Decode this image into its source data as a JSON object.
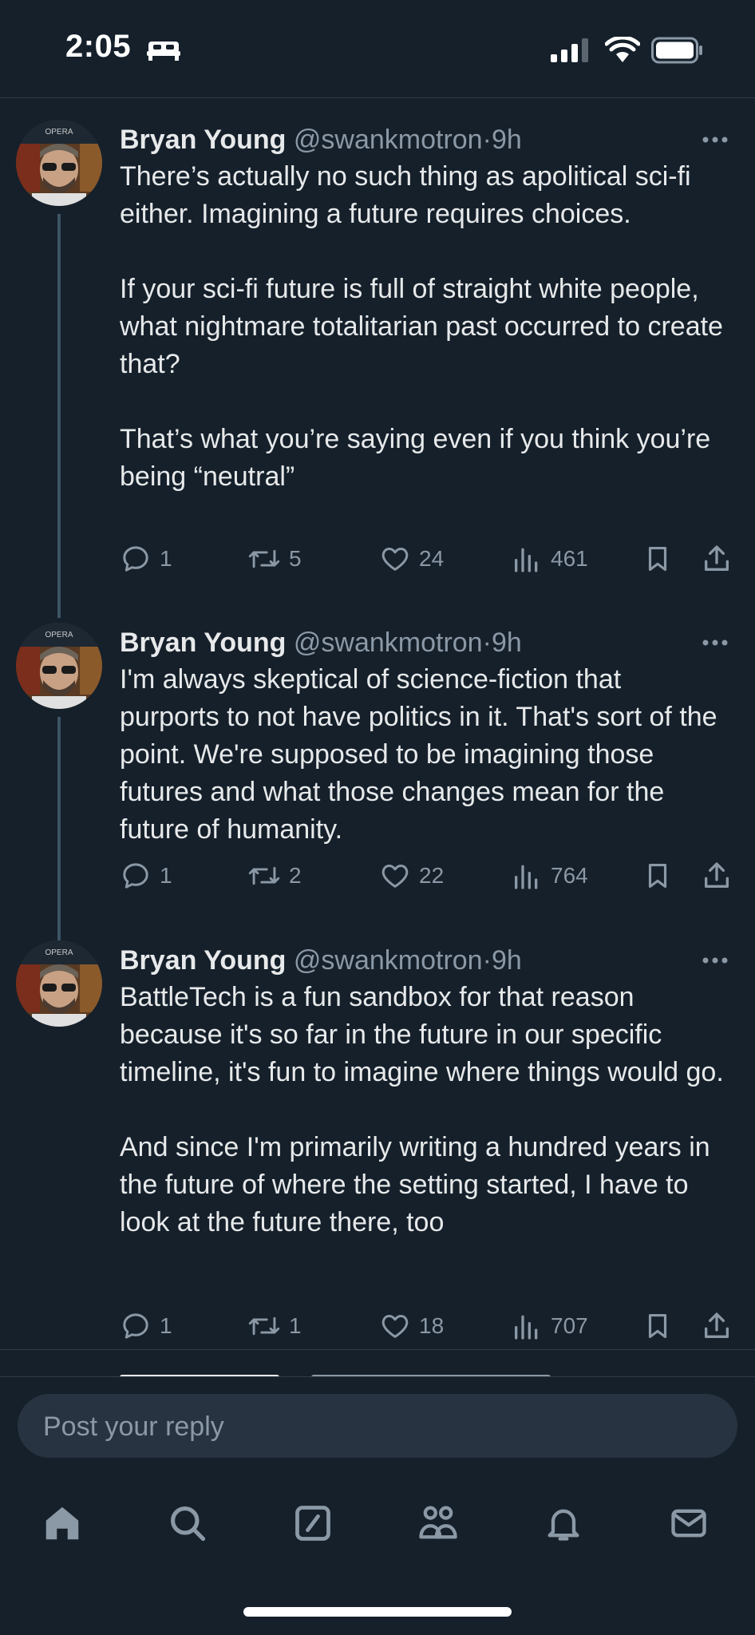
{
  "status_bar": {
    "time": "2:05"
  },
  "tweets": [
    {
      "name": "Bryan Young",
      "handle": "@swankmotron",
      "sep": "·",
      "time": "9h",
      "text": "There’s actually no such thing as apolitical sci-fi either. Imagining a future requires choices.\n\nIf your sci-fi future is full of straight white people, what nightmare totalitarian past occurred to create that?\n\nThat’s what you’re saying even if you think you’re being “neutral”",
      "replies": "1",
      "retweets": "5",
      "likes": "24",
      "views": "461"
    },
    {
      "name": "Bryan Young",
      "handle": "@swankmotron",
      "sep": "·",
      "time": "9h",
      "text": "I'm always skeptical of science-fiction that purports to not have politics in it. That's sort of the point. We're supposed to be imagining those futures and what those changes mean for the future of humanity.",
      "replies": "1",
      "retweets": "2",
      "likes": "22",
      "views": "764"
    },
    {
      "name": "Bryan Young",
      "handle": "@swankmotron",
      "sep": "·",
      "time": "9h",
      "text": "BattleTech is a fun sandbox for that reason because it's so far in the future in our specific timeline, it's fun to imagine where things would go.\n\nAnd since I'm primarily writing a hundred years in the future of where the setting started, I have to look at the future there, too",
      "replies": "1",
      "retweets": "1",
      "likes": "18",
      "views": "707"
    }
  ],
  "reply_box": {
    "placeholder": "Post your reply"
  },
  "nav": [
    "home-icon",
    "search-icon",
    "compose-icon",
    "communities-icon",
    "notifications-icon",
    "messages-icon"
  ],
  "colors": {
    "background": "#15202b",
    "text": "#e7e9ea",
    "muted": "#8b98a5",
    "thread_line": "#3d5466",
    "input_bg": "#273340"
  }
}
